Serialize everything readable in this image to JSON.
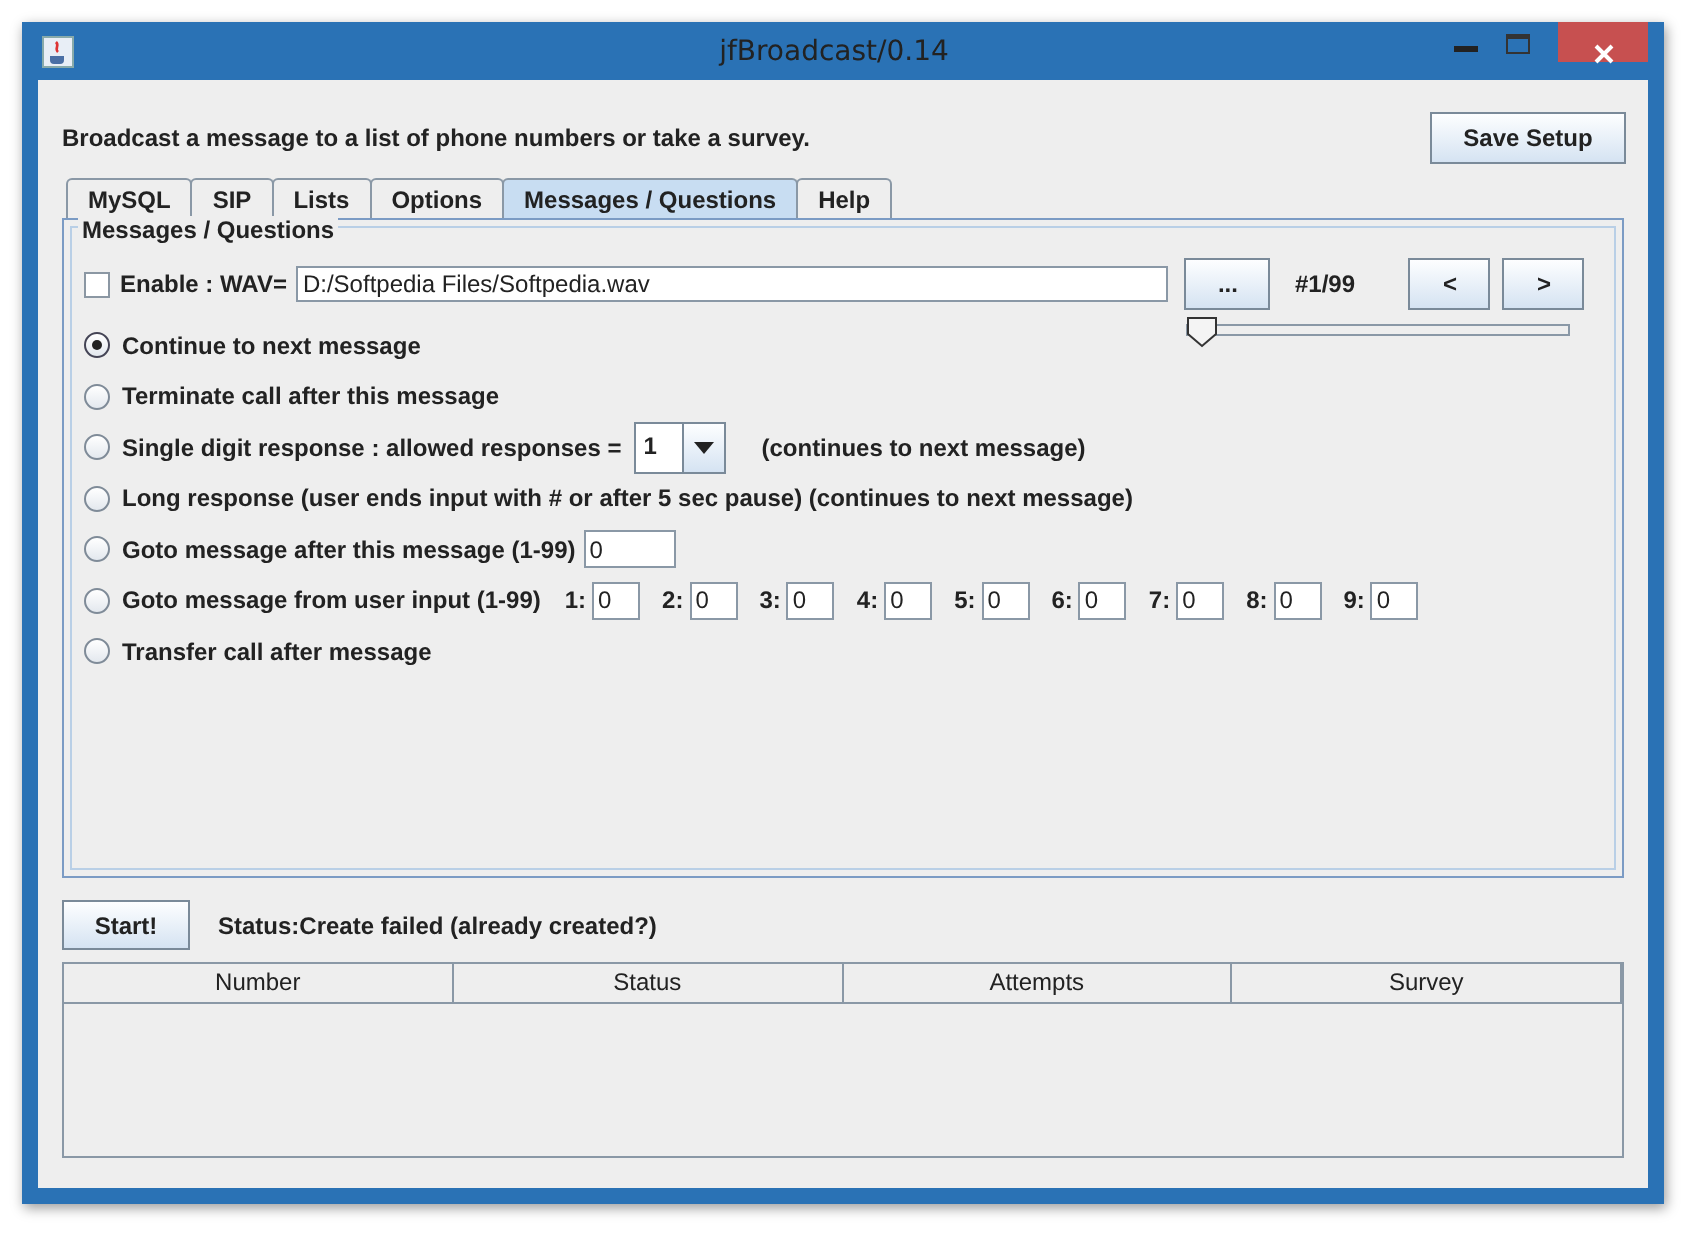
{
  "window": {
    "title": "jfBroadcast/0.14"
  },
  "header": {
    "description": "Broadcast a message to a list of phone numbers or take a survey.",
    "save_button": "Save Setup"
  },
  "tabs": [
    {
      "label": "MySQL",
      "selected": false
    },
    {
      "label": "SIP",
      "selected": false
    },
    {
      "label": "Lists",
      "selected": false
    },
    {
      "label": "Options",
      "selected": false
    },
    {
      "label": "Messages / Questions",
      "selected": true
    },
    {
      "label": "Help",
      "selected": false
    }
  ],
  "panel": {
    "title": "Messages / Questions",
    "enable": {
      "label": "Enable : WAV=",
      "checked": false
    },
    "wav_path": "D:/Softpedia Files/Softpedia.wav",
    "browse_button": "...",
    "message_counter": "#1/99",
    "prev_button": "<",
    "next_button": ">",
    "slider": {
      "level": 0
    },
    "options": [
      {
        "kind": "plain",
        "label": "Continue to next message",
        "selected": true
      },
      {
        "kind": "plain",
        "label": "Terminate call after this message",
        "selected": false
      },
      {
        "kind": "dropdown",
        "label": "Single digit response : allowed responses =",
        "value": "1",
        "note": "(continues to next message)",
        "selected": false
      },
      {
        "kind": "plain",
        "label": "Long response (user ends input with # or after 5 sec pause) (continues to next message)",
        "selected": false
      },
      {
        "kind": "field",
        "label": "Goto message after this message (1-99)",
        "value": "0",
        "selected": false
      },
      {
        "kind": "digits",
        "label": "Goto message from user input (1-99)",
        "selected": false,
        "digits": [
          {
            "label": "1:",
            "value": "0"
          },
          {
            "label": "2:",
            "value": "0"
          },
          {
            "label": "3:",
            "value": "0"
          },
          {
            "label": "4:",
            "value": "0"
          },
          {
            "label": "5:",
            "value": "0"
          },
          {
            "label": "6:",
            "value": "0"
          },
          {
            "label": "7:",
            "value": "0"
          },
          {
            "label": "8:",
            "value": "0"
          },
          {
            "label": "9:",
            "value": "0"
          }
        ]
      },
      {
        "kind": "plain",
        "label": "Transfer call after message",
        "selected": false
      }
    ]
  },
  "start_button": "Start!",
  "status": "Status:Create failed (already created?)",
  "table": {
    "columns": [
      "Number",
      "Status",
      "Attempts",
      "Survey"
    ]
  }
}
